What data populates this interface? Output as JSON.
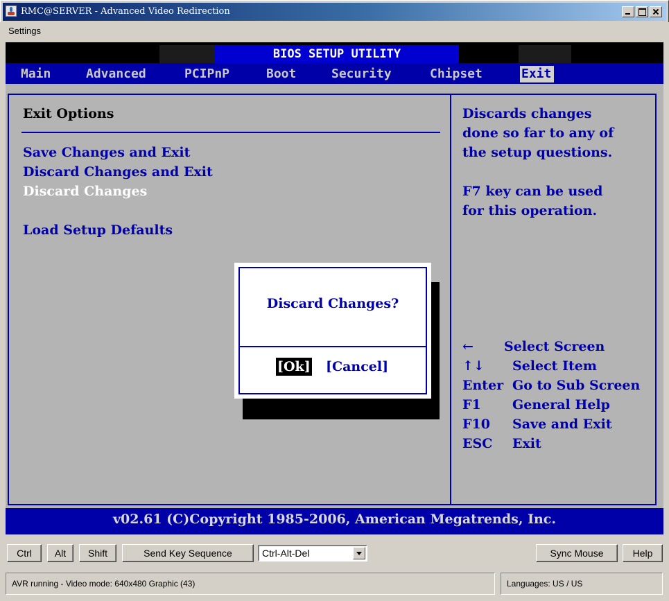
{
  "window": {
    "title": "RMC@SERVER - Advanced Video Redirection",
    "icon": "java-cup-icon"
  },
  "menubar": {
    "settings": "Settings"
  },
  "bios": {
    "title": "BIOS SETUP UTILITY",
    "tabs": [
      {
        "label": "Main"
      },
      {
        "label": "Advanced"
      },
      {
        "label": "PCIPnP"
      },
      {
        "label": "Boot"
      },
      {
        "label": "Security"
      },
      {
        "label": "Chipset"
      },
      {
        "label": "Exit",
        "active": true
      }
    ],
    "section_heading": "Exit Options",
    "options": [
      {
        "label": "Save Changes and Exit"
      },
      {
        "label": "Discard Changes and Exit"
      },
      {
        "label": "Discard Changes",
        "selected": true
      },
      {
        "label": "Load Setup Defaults"
      }
    ],
    "help": {
      "lines": [
        "Discards changes",
        "done so far to any of",
        "the setup questions.",
        "F7 key can be used",
        "for this operation."
      ]
    },
    "keys": [
      {
        "key": "←",
        "desc": "Select Screen"
      },
      {
        "key": "↑↓",
        "desc": "Select Item"
      },
      {
        "key": "Enter",
        "desc": "Go to Sub Screen"
      },
      {
        "key": "F1",
        "desc": "General Help"
      },
      {
        "key": "F10",
        "desc": "Save and Exit"
      },
      {
        "key": "ESC",
        "desc": "Exit"
      }
    ],
    "dialog": {
      "question": "Discard Changes?",
      "ok_label": "[Ok]",
      "cancel_label": "[Cancel]"
    },
    "footer": "v02.61 (C)Copyright 1985-2006, American Megatrends, Inc.",
    "colors": {
      "blue": "#0000a8",
      "body_gray": "#b4b4b4",
      "selected_text": "#ffffff"
    }
  },
  "toolbar": {
    "ctrl": "Ctrl",
    "alt": "Alt",
    "shift": "Shift",
    "send_key_sequence": "Send Key Sequence",
    "key_sequence_value": "Ctrl-Alt-Del",
    "sync_mouse": "Sync Mouse",
    "help": "Help"
  },
  "status": {
    "left": "AVR running - Video mode: 640x480 Graphic (43)",
    "right": "Languages: US / US"
  }
}
